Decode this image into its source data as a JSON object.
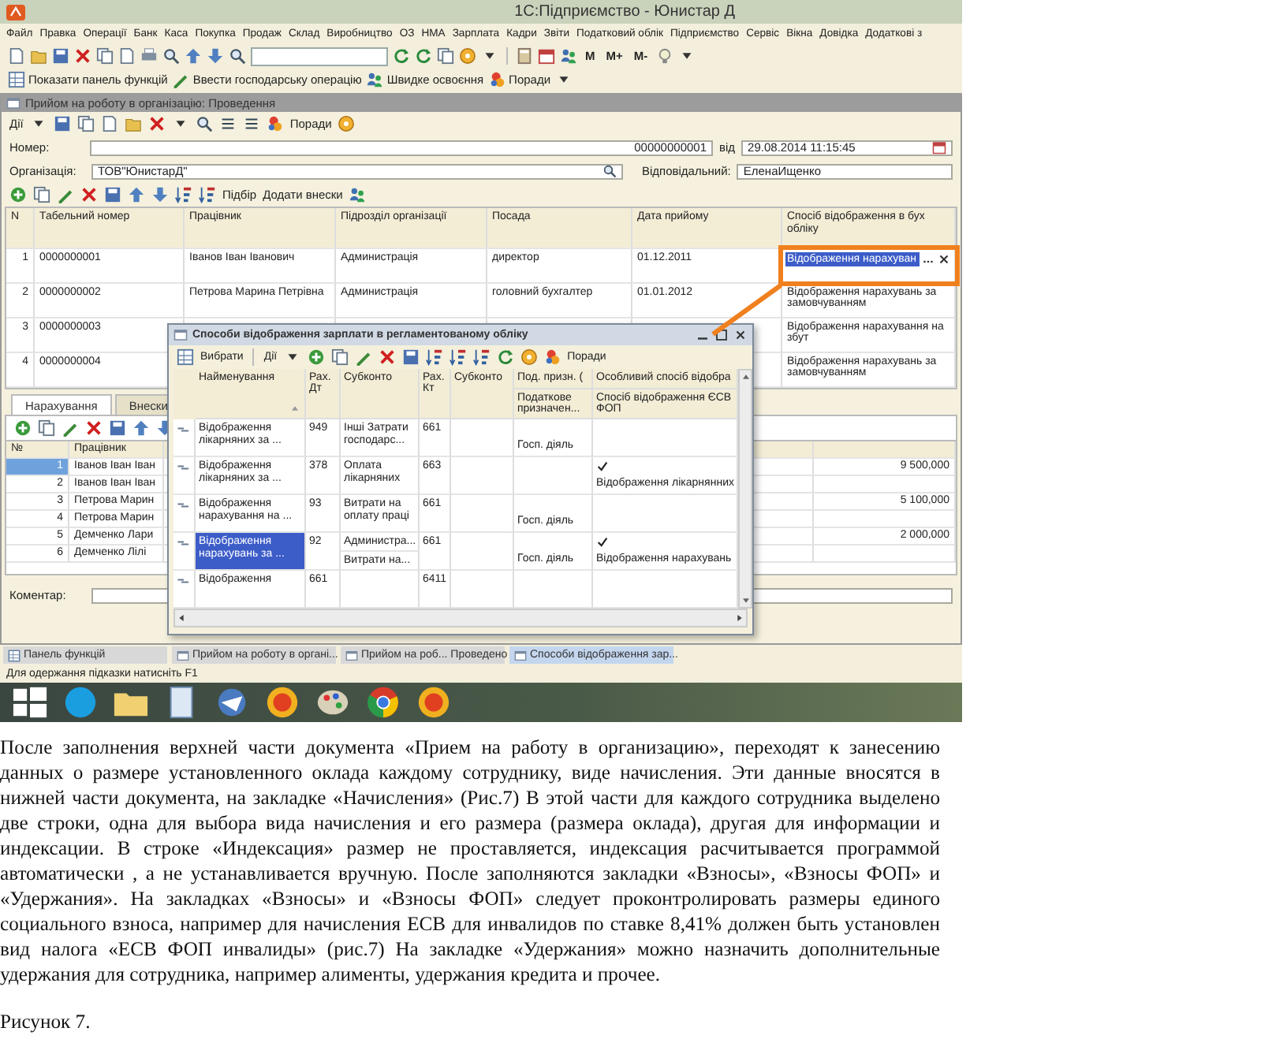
{
  "window": {
    "title": "1С:Підприємство - Юнистар Д"
  },
  "menu": [
    "Файл",
    "Правка",
    "Операції",
    "Банк",
    "Каса",
    "Покупка",
    "Продаж",
    "Склад",
    "Виробництво",
    "ОЗ",
    "НМА",
    "Зарплата",
    "Кадри",
    "Звіти",
    "Податковий облік",
    "Підприємство",
    "Сервіс",
    "Вікна",
    "Довідка",
    "Додаткові з"
  ],
  "toolbar": {
    "memory_buttons": [
      "M",
      "M+",
      "M-"
    ]
  },
  "quick_bar": [
    "Показати панель функцій",
    "Ввести господарську операцію",
    "Швидке освоєння",
    "Поради"
  ],
  "document": {
    "title": "Прийом на роботу в організацію: Проведення",
    "actions": "Дії",
    "tips": "Поради",
    "fields": {
      "number_label": "Номер:",
      "number": "00000000001",
      "date_label": "від",
      "date": "29.08.2014 11:15:45",
      "org_label": "Організація:",
      "org": "ТОВ\"ЮнистарД\"",
      "resp_label": "Відповідальний:",
      "resp": "ЕленаИщенко"
    },
    "table_tools": [
      "Підбір",
      "Додати внески"
    ],
    "table": {
      "columns": [
        "N",
        "Табельний номер",
        "Працівник",
        "Підрозділ організації",
        "Посада",
        "Дата прийому",
        "Спосіб відображення в бух обліку"
      ],
      "rows": [
        {
          "n": "1",
          "tab_no": "0000000001",
          "employee": "Іванов Іван Іванович",
          "department": "Администрація",
          "position": "директор",
          "date": "01.12.2011",
          "method": "Відображення нарахуван",
          "selected": true
        },
        {
          "n": "2",
          "tab_no": "0000000002",
          "employee": "Петрова Марина Петрівна",
          "department": "Администрація",
          "position": "головний бухгалтер",
          "date": "01.01.2012",
          "method": "Відображення нарахувань за замовчуванням",
          "selected": false
        },
        {
          "n": "3",
          "tab_no": "0000000003",
          "method": "Відображення нарахування на збут",
          "selected": false
        },
        {
          "n": "4",
          "tab_no": "0000000004",
          "method": "Відображення нарахувань за замовчуванням",
          "selected": false
        }
      ]
    },
    "tabs": [
      {
        "label": "Нарахування",
        "selected": true
      },
      {
        "label": "Внески",
        "selected": false
      }
    ],
    "accruals": {
      "columns": [
        "№",
        "Працівник"
      ],
      "rows": [
        {
          "n": "1",
          "employee": "Іванов Іван Іван",
          "amount": "9 500,000",
          "selected": true
        },
        {
          "n": "2",
          "employee": "Іванов Іван Іван",
          "selected": false
        },
        {
          "n": "3",
          "employee": "Петрова Марин",
          "amount": "5 100,000",
          "selected": false
        },
        {
          "n": "4",
          "employee": "Петрова Марин",
          "selected": false
        },
        {
          "n": "5",
          "employee": "Демченко Лари",
          "amount": "2 000,000",
          "selected": false
        },
        {
          "n": "6",
          "employee": "Демченко Лілі",
          "selected": false
        }
      ]
    },
    "comment_label": "Коментар:"
  },
  "popup": {
    "title": "Способи відображення зарплати в регламентованому обліку",
    "choose": "Вибрати",
    "actions": "Дії",
    "tips": "Поради",
    "columns": [
      "Найменування",
      "Рах. Дт",
      "Субконто",
      "Рах. Кт",
      "Субконто",
      "Под. призн. (",
      "Особливий спосіб відобра"
    ],
    "subcolumns": [
      "Податкове призначен...",
      "Спосіб відображення ЄСВ ФОП"
    ],
    "rows": [
      {
        "name": "Відображення лікарняних за ...",
        "dt": "949",
        "subconto": [
          "Інші Затрати господарс..."
        ],
        "kt": "661",
        "tax": "Госп. діяль",
        "checked": false,
        "selected": false
      },
      {
        "name": "Відображення лікарняних за ...",
        "dt": "378",
        "subconto": [
          "Оплата лікарняних"
        ],
        "kt": "663",
        "checked": true,
        "method": "Відображення лікарнянних",
        "selected": false
      },
      {
        "name": "Відображення нарахування на ...",
        "dt": "93",
        "subconto": [
          "Витрати на оплату праці"
        ],
        "kt": "661",
        "tax": "Госп. діяль",
        "checked": false,
        "selected": false
      },
      {
        "name": "Відображення нарахувань за ...",
        "dt": "92",
        "subconto": [
          "Администра...",
          "Витрати на..."
        ],
        "kt": "661",
        "tax": "Госп. діяль",
        "checked": true,
        "method": "Відображення нарахувань",
        "selected": true
      },
      {
        "name": "Відображення",
        "dt": "661",
        "subconto": [],
        "kt": "6411",
        "checked": false,
        "selected": false
      }
    ]
  },
  "open_windows": [
    {
      "label": "Панель функцій",
      "selected": false
    },
    {
      "label": "Прийом на роботу в органі...",
      "selected": false
    },
    {
      "label": "Прийом на роб... Проведено",
      "selected": false
    },
    {
      "label": "Способи відображення зар...",
      "selected": true
    }
  ],
  "status_bar": "Для одержання підказки натисніть F1",
  "article": {
    "paragraph": "После заполнения верхней части документа «Прием на работу в организацию», переходят к занесению данных о размере установленного оклада каждому сотруднику, виде начисления. Эти данные вносятся в нижней части документа, на закладке «Начисления» (Рис.7) В этой части для каждого сотрудника выделено две строки, одна для выбора вида начисления и его размера (размера оклада), другая для информации и индексации. В строке «Индексация» размер не проставляется, индексация расчитывается программой автоматически , а не устанавливается вручную. После заполняются закладки «Взносы», «Взносы ФОП» и «Удержания». На закладках «Взносы» и «Взносы ФОП» следует проконтролировать размеры единого социального взноса, например для начисления ЕСВ для инвалидов по ставке 8,41% должен быть установлен вид налога «ЕСВ ФОП инвалиды» (рис.7) На закладке «Удержания» можно назначить дополнительные удержания для сотрудника, например алименты, удержания кредита и прочее.",
    "caption": "Рисунок 7."
  }
}
